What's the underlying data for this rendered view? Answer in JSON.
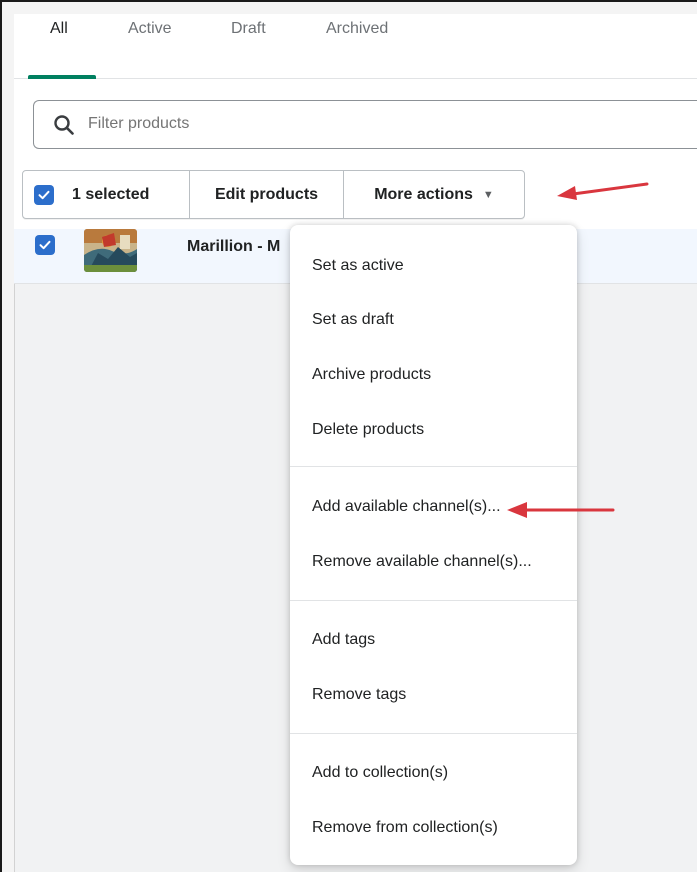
{
  "tabs": [
    {
      "label": "All",
      "active": true
    },
    {
      "label": "Active",
      "active": false
    },
    {
      "label": "Draft",
      "active": false
    },
    {
      "label": "Archived",
      "active": false
    }
  ],
  "search": {
    "placeholder": "Filter products",
    "icon": "search-icon"
  },
  "bulk_actions": {
    "selected_label": "1 selected",
    "edit_label": "Edit products",
    "more_label": "More actions",
    "caret_glyph": "▼"
  },
  "product_row": {
    "name": "Marillion - M",
    "checked": true
  },
  "menu": {
    "sections": [
      [
        "Set as active",
        "Set as draft",
        "Archive products",
        "Delete products"
      ],
      [
        "Add available channel(s)...",
        "Remove available channel(s)..."
      ],
      [
        "Add tags",
        "Remove tags"
      ],
      [
        "Add to collection(s)",
        "Remove from collection(s)"
      ]
    ]
  },
  "colors": {
    "accent": "#008060",
    "checkbox": "#2c6ecb",
    "annotation_arrow": "#d9363e"
  }
}
